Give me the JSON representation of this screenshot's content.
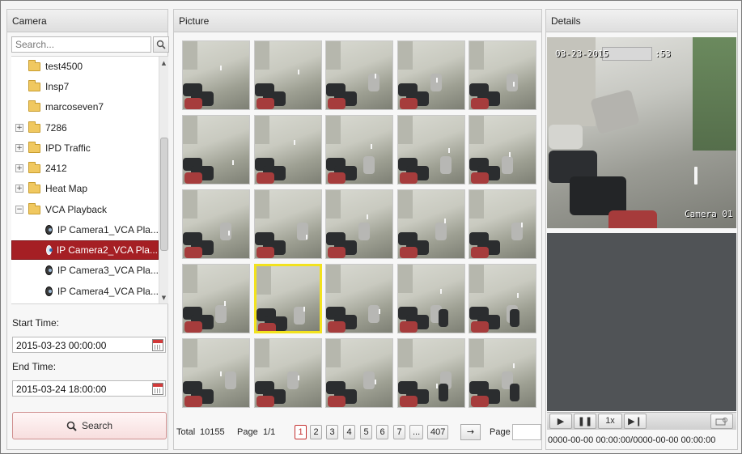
{
  "camera_panel": {
    "title": "Camera",
    "search_placeholder": "Search...",
    "tree": [
      {
        "label": "test4500",
        "type": "folder",
        "expander": ""
      },
      {
        "label": "Insp7",
        "type": "folder",
        "expander": ""
      },
      {
        "label": "marcoseven7",
        "type": "folder",
        "expander": ""
      },
      {
        "label": "7286",
        "type": "folder",
        "expander": "+"
      },
      {
        "label": "IPD Traffic",
        "type": "folder",
        "expander": "+"
      },
      {
        "label": "2412",
        "type": "folder",
        "expander": "+"
      },
      {
        "label": "Heat Map",
        "type": "folder",
        "expander": "+"
      },
      {
        "label": "VCA Playback",
        "type": "folder",
        "expander": "−"
      },
      {
        "label": "IP Camera1_VCA Pla...",
        "type": "camera",
        "expander": ""
      },
      {
        "label": "IP Camera2_VCA Pla...",
        "type": "camera",
        "expander": "",
        "selected": true
      },
      {
        "label": "IP Camera3_VCA Pla...",
        "type": "camera",
        "expander": ""
      },
      {
        "label": "IP Camera4_VCA Pla...",
        "type": "camera",
        "expander": ""
      }
    ],
    "start_time_label": "Start Time:",
    "start_time_value": "2015-03-23 00:00:00",
    "end_time_label": "End Time:",
    "end_time_value": "2015-03-24 18:00:00",
    "search_button": "Search"
  },
  "picture_panel": {
    "title": "Picture",
    "selected_thumbnail": 16,
    "pager": {
      "total_label": "Total",
      "total_value": "10155",
      "page_label": "Page",
      "page_value": "1/1",
      "pages": [
        "1",
        "2",
        "3",
        "4",
        "5",
        "6",
        "7",
        "...",
        "407"
      ],
      "active_page": "1",
      "goto_label": "Page"
    }
  },
  "details_panel": {
    "title": "Details",
    "video_date": "03-23-2015",
    "video_time_tail": ":53",
    "camera_overlay": "Camera 01",
    "controls": {
      "play_icon": "play-icon",
      "pause_icon": "pause-icon",
      "speed": "1x",
      "step_icon": "step-forward-icon",
      "capture_icon": "capture-icon"
    },
    "time_range": "0000-00-00 00:00:00/0000-00-00 00:00:00"
  },
  "colors": {
    "selected_row": "#a51f24",
    "thumb_highlight": "#f2e21e",
    "active_page": "#c43030"
  }
}
